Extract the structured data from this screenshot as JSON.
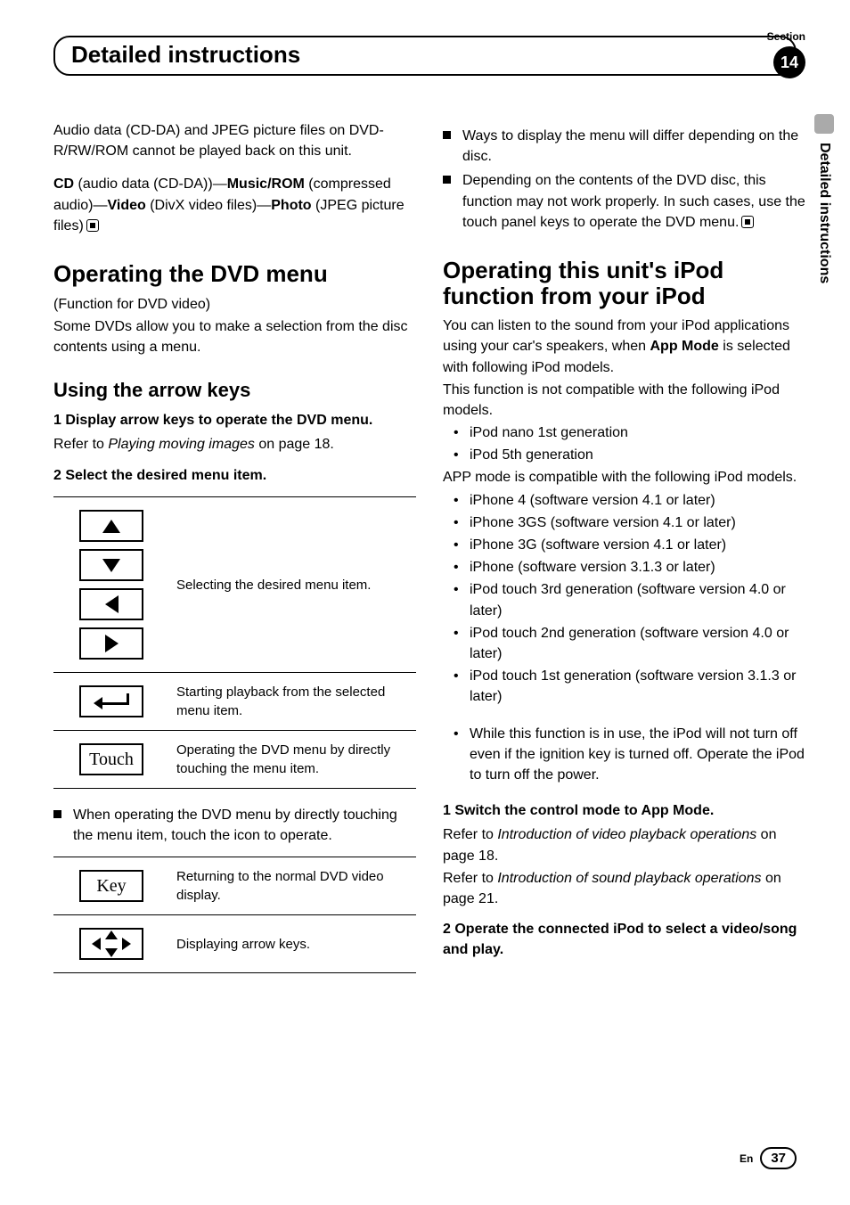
{
  "header": {
    "section_label": "Section",
    "chapter_title": "Detailed instructions",
    "section_number": "14",
    "side_tab": "Detailed instructions"
  },
  "left": {
    "p1_a": "Audio data (CD-DA) and JPEG picture files on DVD-R/RW/ROM cannot be played back on this unit.",
    "p2_cd": "CD",
    "p2_a": " (audio data (CD-DA))—",
    "p2_music": "Music/ROM",
    "p2_b": " (compressed audio)—",
    "p2_video": "Video",
    "p2_c": " (DivX video files)—",
    "p2_photo": "Photo",
    "p2_d": " (JPEG picture files)",
    "h1": "Operating the DVD menu",
    "p3": "(Function for DVD video)",
    "p4": "Some DVDs allow you to make a selection from the disc contents using a menu.",
    "h2": "Using the arrow keys",
    "step1": "1    Display arrow keys to operate the DVD menu.",
    "step1_ref_a": "Refer to ",
    "step1_ref_i": "Playing moving images",
    "step1_ref_b": " on page 18.",
    "step2": "2    Select the desired menu item.",
    "t1_arrows_desc": "Selecting the desired menu item.",
    "t1_enter_desc": "Starting playback from the selected menu item.",
    "t1_touch_label": "Touch",
    "t1_touch_desc": "Operating the DVD menu by directly touching the menu item.",
    "note1": "When operating the DVD menu by directly touching the menu item, touch the icon to operate.",
    "t2_key_label": "Key",
    "t2_key_desc": "Returning to the normal DVD video display.",
    "t2_dpad_desc": "Displaying arrow keys."
  },
  "right": {
    "note_a": "Ways to display the menu will differ depending on the disc.",
    "note_b": "Depending on the contents of the DVD disc, this function may not work properly. In such cases, use the touch panel keys to operate the DVD menu.",
    "h1_a": "Operating this unit's iPod function from your iPod",
    "p5_a": "You can listen to the sound from your iPod applications using your car's speakers, when ",
    "p5_b": "App Mode",
    "p5_c": " is selected with following iPod models.",
    "p6": "This function is not compatible with the following iPod models.",
    "incompat": [
      "iPod nano 1st generation",
      "iPod 5th generation"
    ],
    "p7": "APP mode is compatible with the following iPod models.",
    "compat": [
      "iPhone 4 (software version 4.1 or later)",
      "iPhone 3GS (software version 4.1 or later)",
      "iPhone 3G (software version 4.1 or later)",
      "iPhone (software version 3.1.3 or later)",
      "iPod touch 3rd generation (software version 4.0 or later)",
      "iPod touch 2nd generation (software version 4.0 or later)",
      "iPod touch 1st generation (software version 3.1.3 or later)"
    ],
    "note_c": "While this function is in use, the iPod will not turn off even if the ignition key is turned off. Operate the iPod to turn off the power.",
    "step1": "1    Switch the control mode to App Mode.",
    "step1_ref1_a": "Refer to ",
    "step1_ref1_i": "Introduction of video playback operations",
    "step1_ref1_b": " on page 18.",
    "step1_ref2_a": "Refer to ",
    "step1_ref2_i": "Introduction of sound playback operations",
    "step1_ref2_b": " on page 21.",
    "step2": "2    Operate the connected iPod to select a video/song and play."
  },
  "footer": {
    "lang": "En",
    "page": "37"
  }
}
